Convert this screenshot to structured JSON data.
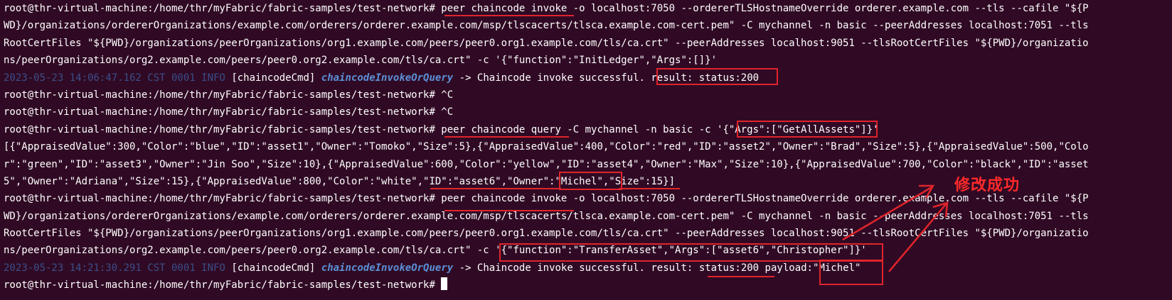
{
  "terminal": {
    "lines": [
      "root@thr-virtual-machine:/home/thr/myFabric/fabric-samples/test-network# peer chaincode invoke -o localhost:7050 --ordererTLSHostnameOverride orderer.example.com --tls --cafile \"${P",
      "WD}/organizations/ordererOrganizations/example.com/orderers/orderer.example.com/msp/tlscacerts/tlsca.example.com-cert.pem\" -C mychannel -n basic --peerAddresses localhost:7051 --tls",
      "RootCertFiles \"${PWD}/organizations/peerOrganizations/org1.example.com/peers/peer0.org1.example.com/tls/ca.crt\" --peerAddresses localhost:9051 --tlsRootCertFiles \"${PWD}/organizatio",
      "ns/peerOrganizations/org2.example.com/peers/peer0.org2.example.com/tls/ca.crt\" -c '{\"function\":\"InitLedger\",\"Args\":[]}'",
      "",
      "root@thr-virtual-machine:/home/thr/myFabric/fabric-samples/test-network# ^C",
      "root@thr-virtual-machine:/home/thr/myFabric/fabric-samples/test-network# ^C",
      "root@thr-virtual-machine:/home/thr/myFabric/fabric-samples/test-network# peer chaincode query -C mychannel -n basic -c '{\"Args\":[\"GetAllAssets\"]}'",
      "[{\"AppraisedValue\":300,\"Color\":\"blue\",\"ID\":\"asset1\",\"Owner\":\"Tomoko\",\"Size\":5},{\"AppraisedValue\":400,\"Color\":\"red\",\"ID\":\"asset2\",\"Owner\":\"Brad\",\"Size\":5},{\"AppraisedValue\":500,\"Colo",
      "r\":\"green\",\"ID\":\"asset3\",\"Owner\":\"Jin Soo\",\"Size\":10},{\"AppraisedValue\":600,\"Color\":\"yellow\",\"ID\":\"asset4\",\"Owner\":\"Max\",\"Size\":10},{\"AppraisedValue\":700,\"Color\":\"black\",\"ID\":\"asset",
      "5\",\"Owner\":\"Adriana\",\"Size\":15},{\"AppraisedValue\":800,\"Color\":\"white\",\"ID\":\"asset6\",\"Owner\":\"Michel\",\"Size\":15}]",
      "root@thr-virtual-machine:/home/thr/myFabric/fabric-samples/test-network# peer chaincode invoke -o localhost:7050 --ordererTLSHostnameOverride orderer.example.com --tls --cafile \"${P",
      "WD}/organizations/ordererOrganizations/example.com/orderers/orderer.example.com/msp/tlscacerts/tlsca.example.com-cert.pem\" -C mychannel -n basic --peerAddresses localhost:7051 --tls",
      "RootCertFiles \"${PWD}/organizations/peerOrganizations/org1.example.com/peers/peer0.org1.example.com/tls/ca.crt\" --peerAddresses localhost:9051 --tlsRootCertFiles \"${PWD}/organizatio",
      "ns/peerOrganizations/org2.example.com/peers/peer0.org2.example.com/tls/ca.crt\" -c '{\"function\":\"TransferAsset\",\"Args\":[\"asset6\",\"Christopher\"]}'",
      "",
      "root@thr-virtual-machine:/home/thr/myFabric/fabric-samples/test-network# "
    ],
    "log1": {
      "timestamp": "2023-05-23 14:06:47.162 CST 0001 INFO",
      "tag": "[chaincodeCmd]",
      "func": "chaincodeInvokeOrQuery",
      "message": "-> Chaincode invoke successful.",
      "result": "result: status:200"
    },
    "log2": {
      "timestamp": "2023-05-23 14:21:30.291 CST 0001 INFO",
      "tag": "[chaincodeCmd]",
      "func": "chaincodeInvokeOrQuery",
      "message": "-> Chaincode invoke successful. result:",
      "status": "status:200",
      "payload_label": "payload:",
      "payload": "\"Michel\""
    }
  },
  "annotation": {
    "note": "修改成功",
    "color": "#e0242b"
  },
  "colors": {
    "background": "#300a24",
    "text": "#ffffff",
    "log": "#3b4e8a",
    "func": "#5b8fd6"
  }
}
